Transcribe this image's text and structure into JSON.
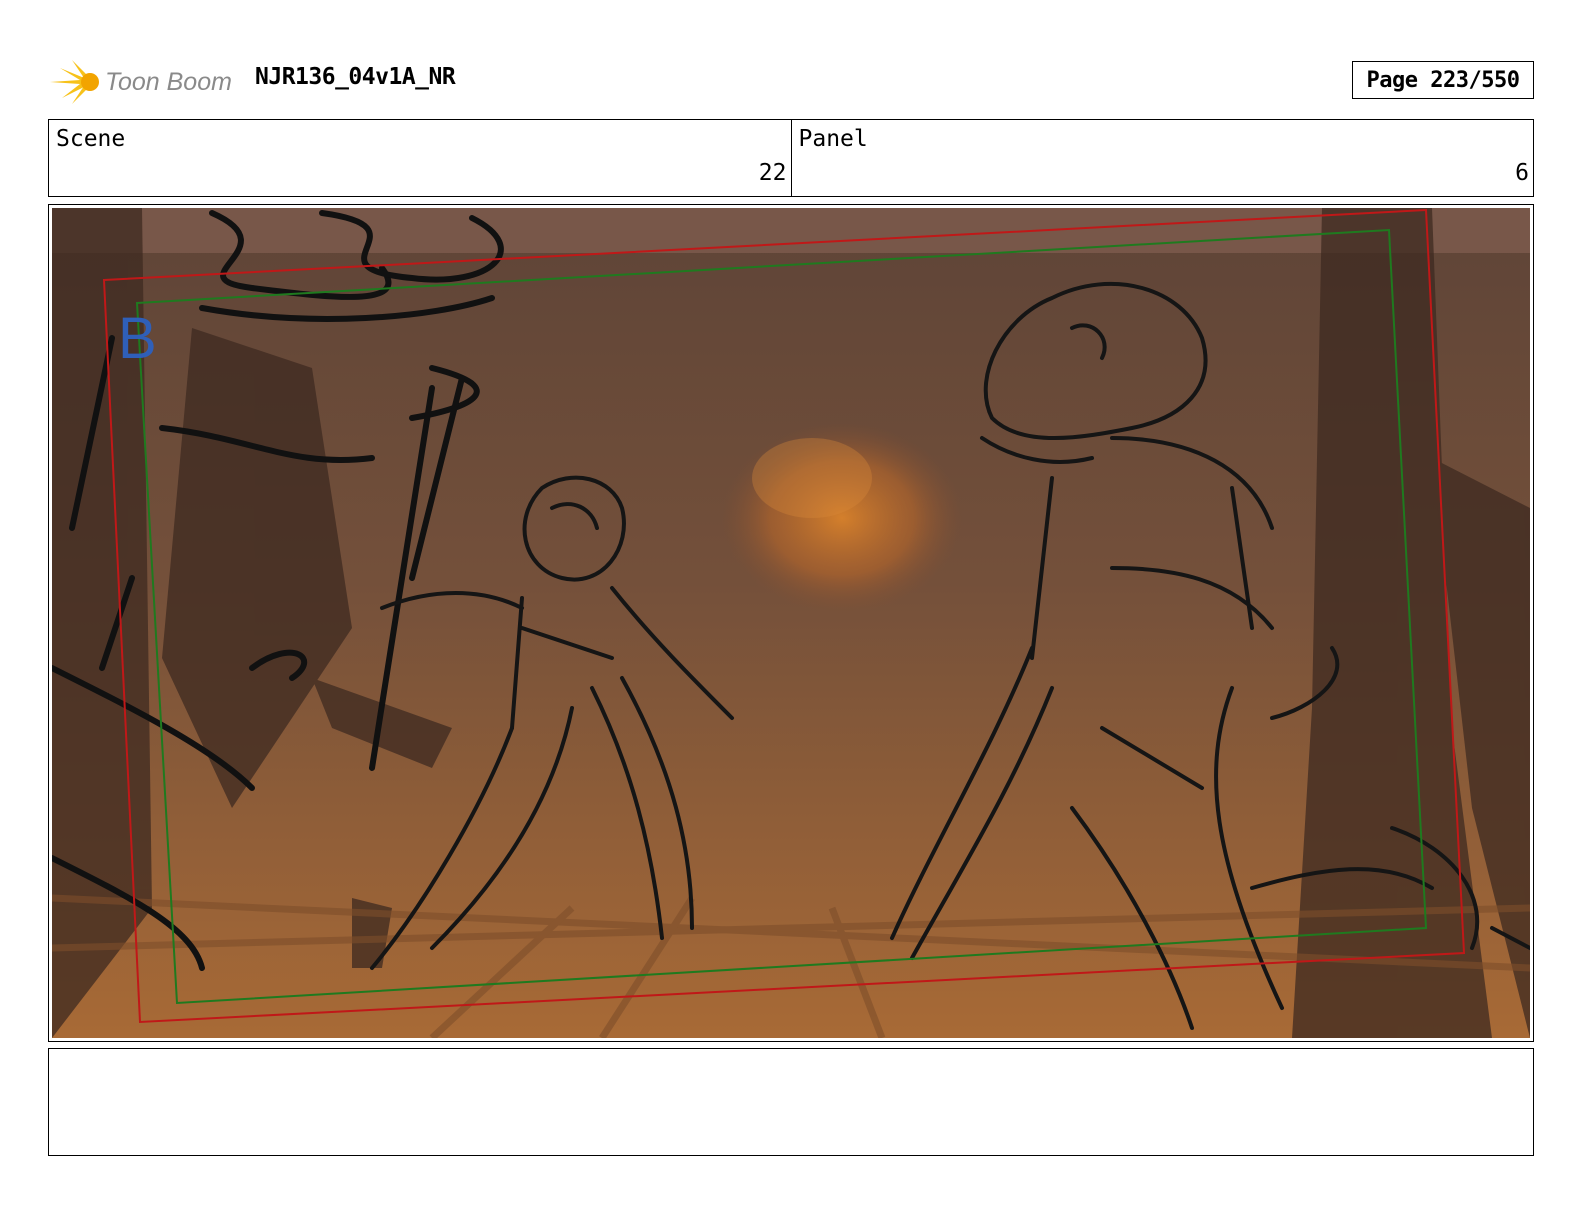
{
  "header": {
    "brand_logo": "Toon Boom",
    "document_title": "NJR136_04v1A_NR",
    "page_indicator": "Page 223/550"
  },
  "info": {
    "scene_label": "Scene",
    "scene_value": "22",
    "panel_label": "Panel",
    "panel_value": "6"
  },
  "panel": {
    "layer_marker": "B",
    "description": "Rough storyboard sketch: two figures in a brown, smoky forest with an orange glowing cloud between them; red and green camera frames overlaid"
  },
  "caption": {
    "text": ""
  },
  "colors": {
    "camera_frame_red": "#c01818",
    "camera_frame_green": "#1f7a1f",
    "layer_marker_blue": "#2f5fb8",
    "glow_orange": "#d9822b"
  }
}
